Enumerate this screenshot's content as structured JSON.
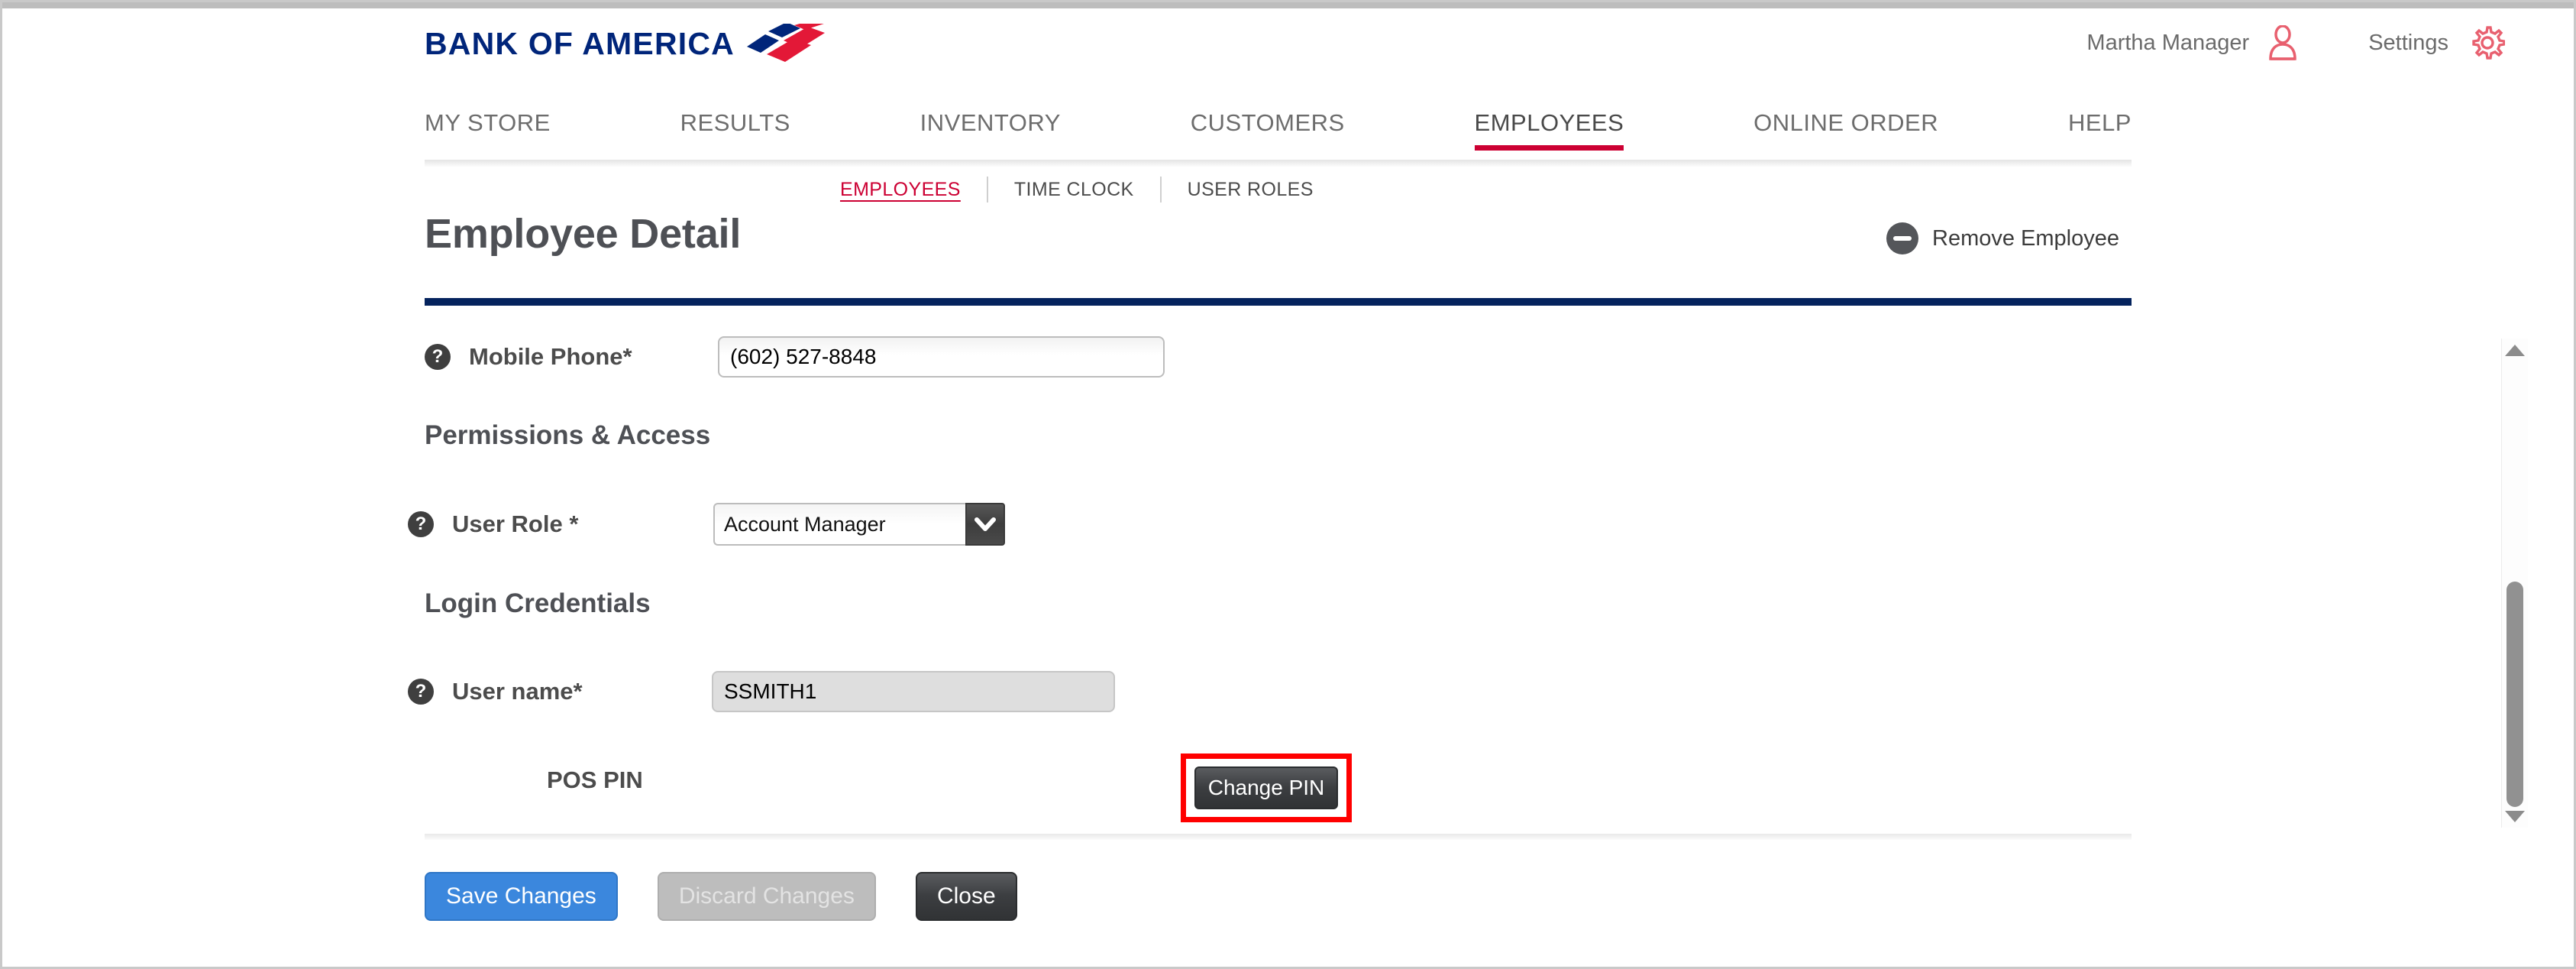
{
  "brand": {
    "name": "BANK OF AMERICA",
    "flag_navy": "#00257a",
    "flag_red": "#e31837"
  },
  "header": {
    "user_name": "Martha Manager",
    "user_icon": "person-icon",
    "settings_label": "Settings",
    "settings_icon": "gear-icon",
    "accent_pink": "#e8606f"
  },
  "main_nav": {
    "active": "EMPLOYEES",
    "active_color": "#cc0033",
    "items": [
      {
        "label": "MY STORE"
      },
      {
        "label": "RESULTS"
      },
      {
        "label": "INVENTORY"
      },
      {
        "label": "CUSTOMERS"
      },
      {
        "label": "EMPLOYEES"
      },
      {
        "label": "ONLINE ORDER"
      },
      {
        "label": "HELP"
      }
    ]
  },
  "sub_nav": {
    "active": "EMPLOYEES",
    "items": [
      {
        "label": "EMPLOYEES"
      },
      {
        "label": "TIME CLOCK"
      },
      {
        "label": "USER ROLES"
      }
    ]
  },
  "page": {
    "title": "Employee Detail",
    "remove_label": "Remove Employee",
    "remove_icon": "minus-circle-icon",
    "rule_color": "#04235d"
  },
  "form": {
    "mobile_phone": {
      "label": "Mobile Phone*",
      "value": "(602) 527-8848",
      "help_icon": "help-icon"
    },
    "permissions_heading": "Permissions & Access",
    "user_role": {
      "label": "User Role *",
      "value": "Account Manager",
      "help_icon": "help-icon",
      "arrow_icon": "chevron-down-icon"
    },
    "login_heading": "Login Credentials",
    "user_name": {
      "label": "User name*",
      "value": "SSMITH1",
      "help_icon": "help-icon"
    },
    "pos_pin": {
      "label": "POS PIN",
      "button_label": "Change PIN",
      "highlight_color": "#ff0000"
    }
  },
  "scrollbar": {
    "up_icon": "scroll-up-arrow-icon",
    "down_icon": "scroll-down-arrow-icon"
  },
  "footer": {
    "save_label": "Save Changes",
    "discard_label": "Discard Changes",
    "close_label": "Close"
  }
}
